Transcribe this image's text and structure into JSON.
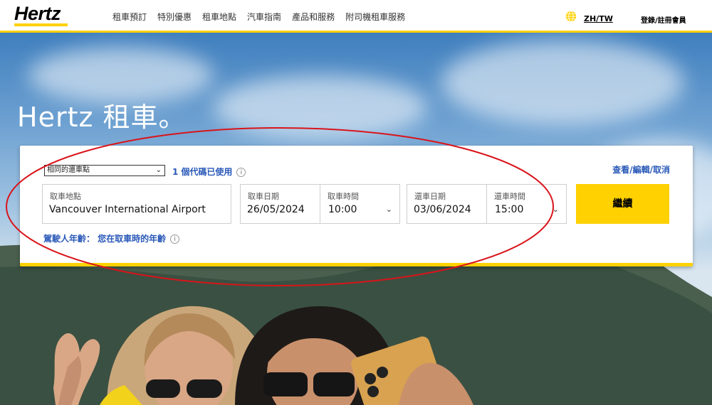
{
  "header": {
    "logo": "Hertz",
    "nav": [
      "租車預訂",
      "特別優惠",
      "租車地點",
      "汽車指南",
      "產品和服務",
      "附司機租車服務"
    ],
    "language": "ZH/TW",
    "login": "登錄/註冊會員"
  },
  "hero": {
    "title": "Hertz 租車。"
  },
  "booking": {
    "return_location_option": "相同的還車點",
    "promo_count": "1",
    "promo_text": "個代碼已使用",
    "manage_view": "查看",
    "manage_edit": "編輯",
    "manage_cancel": "取消",
    "pickup_location_label": "取車地點",
    "pickup_location_value": "Vancouver International Airport",
    "pickup_date_label": "取車日期",
    "pickup_date_value": "26/05/2024",
    "pickup_time_label": "取車時間",
    "pickup_time_value": "10:00",
    "return_date_label": "還車日期",
    "return_date_value": "03/06/2024",
    "return_time_label": "還車時間",
    "return_time_value": "15:00",
    "continue_label": "繼續",
    "driver_age_text": "駕駛人年齡： 您在取車時的年齡"
  },
  "colors": {
    "brand_yellow": "#ffd100",
    "link_blue": "#2a59b8",
    "annotation_red": "#d9141a"
  }
}
